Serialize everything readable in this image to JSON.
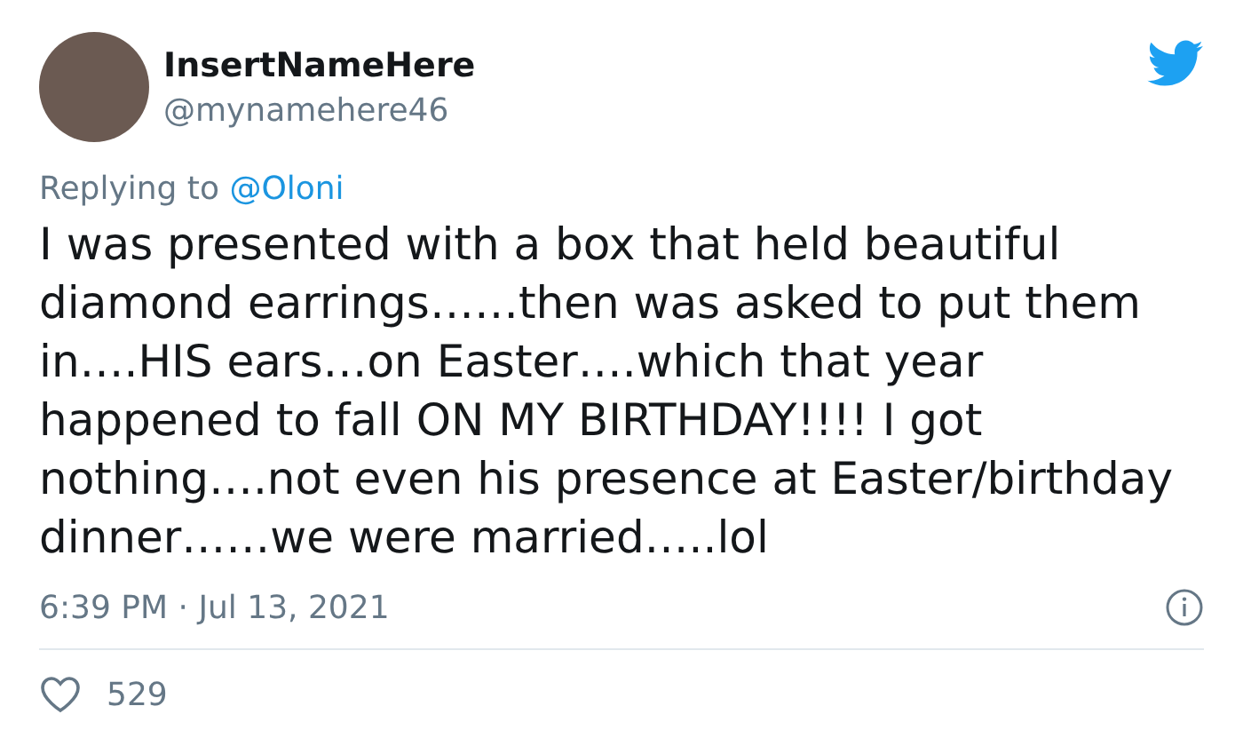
{
  "author": {
    "name": "InsertNameHere",
    "handle": "@mynamehere46"
  },
  "reply": {
    "prefix": "Replying to",
    "handle": "@Oloni"
  },
  "body": "I was presented with a box that held beautiful diamond earrings……then was asked to put them in….HIS ears…on Easter….which that year happened to fall ON MY BIRTHDAY!!!! I got nothing….not even his presence at Easter/birthday dinner……we were married…..lol",
  "timestamp": "6:39 PM · Jul 13, 2021",
  "likes": {
    "count": "529"
  }
}
